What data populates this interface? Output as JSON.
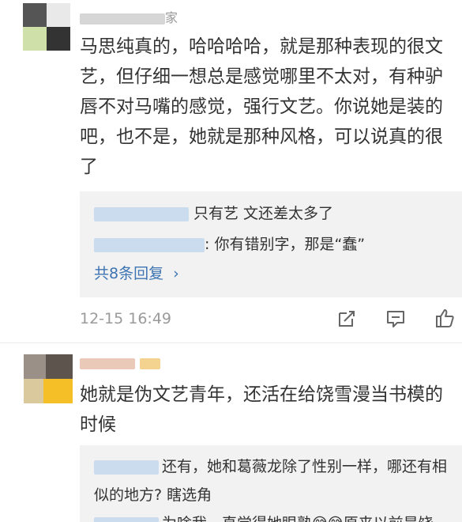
{
  "comment1": {
    "username_suffix": "家",
    "text_lines": [
      "马思纯真的，哈哈哈哈，就是那种表现的很文",
      "艺，但仔细一想总是感觉哪里不太对，有种驴",
      "唇不对马嘴的感觉，强行文艺。你说她是装的",
      "吧，也不是，她就是那种风格，可以说真的很",
      "了"
    ],
    "replies": [
      {
        "name_fragment": "",
        "text": "只有艺 文还差太多了"
      },
      {
        "name_fragment": "",
        "text": ": 你有错别字，那是“蠢”"
      }
    ],
    "more_replies": "共8条回复",
    "more_replies_arrow": "›",
    "timestamp": "12-15 16:49",
    "actions": [
      "share-icon",
      "comment-icon",
      "like-icon"
    ]
  },
  "comment2": {
    "text_lines": [
      "她就是伪文艺青年，还活在给饶雪漫当书模的",
      "时候"
    ],
    "replies": [
      {
        "text_line1": "还有，她和葛薇龙除了性别一样，哪还有相",
        "text_line2": "似的地方? 瞎选角"
      },
      {
        "text": "为啥我一直觉得她眼熟😅😅原来以前是饶"
      }
    ]
  },
  "colors": {
    "link": "#3d74b3",
    "text": "#333333",
    "meta": "#9a9a9a",
    "reply_bg": "#f2f2f2"
  }
}
